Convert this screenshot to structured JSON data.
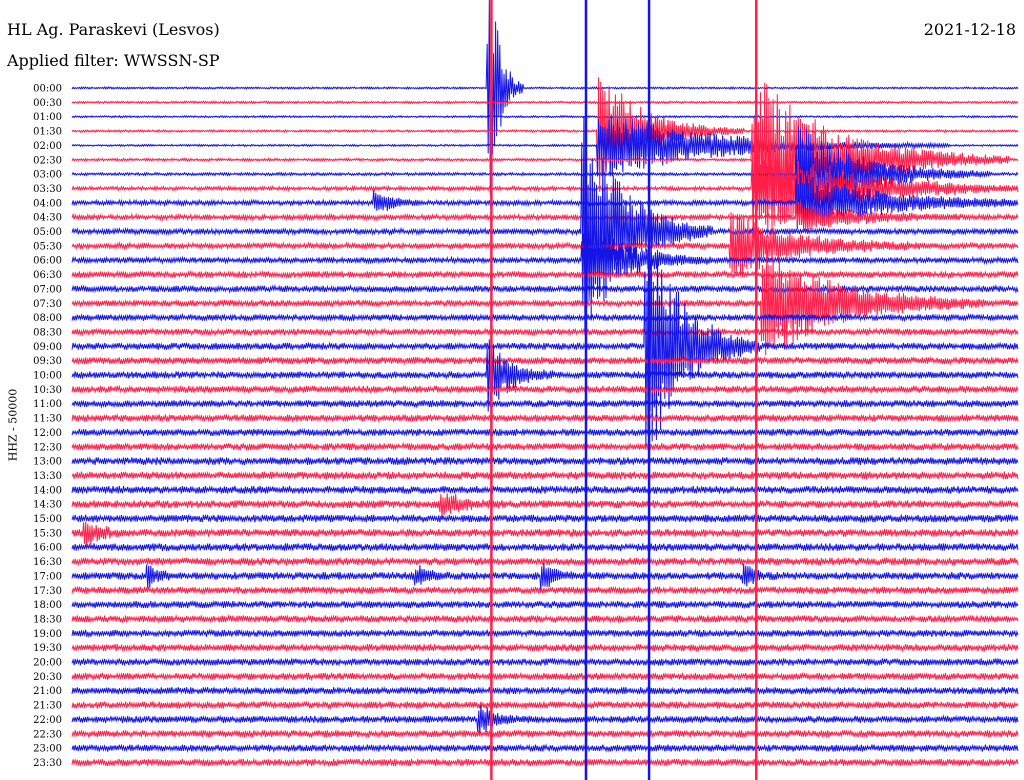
{
  "header": {
    "station": "HL Ag. Paraskevi (Lesvos)",
    "filter": "Applied filter: WWSSN-SP",
    "date": "2021-12-18",
    "channel": "HHZ - 50000"
  },
  "colors": {
    "trace_a": "#1414e6",
    "trace_b": "#ff1f4b"
  },
  "chart_data": {
    "type": "line",
    "title": "HL Ag. Paraskevi (Lesvos)",
    "subtitle": "Applied filter: WWSSN-SP",
    "date": "2021-12-18",
    "ylabel": "HHZ - 50000",
    "xlabel": "",
    "row_labels": [
      "00:00",
      "00:30",
      "01:00",
      "01:30",
      "02:00",
      "02:30",
      "03:00",
      "03:30",
      "04:00",
      "04:30",
      "05:00",
      "05:30",
      "06:00",
      "06:30",
      "07:00",
      "07:30",
      "08:00",
      "08:30",
      "09:00",
      "09:30",
      "10:00",
      "10:30",
      "11:00",
      "11:30",
      "12:00",
      "12:30",
      "13:00",
      "13:30",
      "14:00",
      "14:30",
      "15:00",
      "15:30",
      "16:00",
      "16:30",
      "17:00",
      "17:30",
      "18:00",
      "18:30",
      "19:00",
      "19:30",
      "20:00",
      "20:30",
      "21:00",
      "21:30",
      "22:00",
      "22:30",
      "23:00",
      "23:30"
    ],
    "row_colors": [
      "trace_a",
      "trace_b"
    ],
    "row_noise_level": [
      0.3,
      0.35,
      0.3,
      0.35,
      0.3,
      0.4,
      0.45,
      0.6,
      0.8,
      0.8,
      0.9,
      0.9,
      0.9,
      1.0,
      1.0,
      1.0,
      1.0,
      1.0,
      1.1,
      1.1,
      1.1,
      1.1,
      1.1,
      1.1,
      1.1,
      1.1,
      1.2,
      1.2,
      1.2,
      1.2,
      1.2,
      1.2,
      1.2,
      1.2,
      1.2,
      1.1,
      1.1,
      1.1,
      1.1,
      1.1,
      1.1,
      1.1,
      1.1,
      1.1,
      1.1,
      1.1,
      1.1,
      1.1
    ],
    "events": [
      {
        "row": 0,
        "minute": 13.3,
        "amp": 120,
        "duration": 1.0
      },
      {
        "row": 3,
        "minute": 16.8,
        "amp": 60,
        "duration": 4.5
      },
      {
        "row": 4,
        "minute": 16.8,
        "amp": 35,
        "duration": 11
      },
      {
        "row": 5,
        "minute": 21.7,
        "amp": 90,
        "duration": 8
      },
      {
        "row": 6,
        "minute": 23.1,
        "amp": 55,
        "duration": 6
      },
      {
        "row": 7,
        "minute": 21.7,
        "amp": 50,
        "duration": 9
      },
      {
        "row": 8,
        "minute": 23.1,
        "amp": 30,
        "duration": 8
      },
      {
        "row": 9,
        "minute": 23.1,
        "amp": 15,
        "duration": 6
      },
      {
        "row": 10,
        "minute": 16.3,
        "amp": 120,
        "duration": 4
      },
      {
        "row": 11,
        "minute": 21.0,
        "amp": 35,
        "duration": 6
      },
      {
        "row": 12,
        "minute": 16.3,
        "amp": 45,
        "duration": 4
      },
      {
        "row": 15,
        "minute": 22.0,
        "amp": 60,
        "duration": 7
      },
      {
        "row": 18,
        "minute": 18.3,
        "amp": 130,
        "duration": 3.5
      },
      {
        "row": 20,
        "minute": 13.3,
        "amp": 35,
        "duration": 2
      },
      {
        "row": 8,
        "minute": 9.7,
        "amp": 12,
        "duration": 1.5
      },
      {
        "row": 29,
        "minute": 11.8,
        "amp": 12,
        "duration": 2
      },
      {
        "row": 31,
        "minute": 0.5,
        "amp": 12,
        "duration": 1.5
      },
      {
        "row": 34,
        "minute": 2.5,
        "amp": 10,
        "duration": 1
      },
      {
        "row": 34,
        "minute": 11.0,
        "amp": 10,
        "duration": 1
      },
      {
        "row": 34,
        "minute": 15.0,
        "amp": 12,
        "duration": 1.2
      },
      {
        "row": 34,
        "minute": 21.4,
        "amp": 10,
        "duration": 1
      },
      {
        "row": 44,
        "minute": 13.0,
        "amp": 15,
        "duration": 1.5
      }
    ],
    "spikes": [
      {
        "minute": 13.3,
        "from_row": 0,
        "to_row": 47,
        "color": "trace_b"
      },
      {
        "minute": 16.3,
        "from_row": 0,
        "to_row": 47,
        "color": "trace_a"
      },
      {
        "minute": 18.3,
        "from_row": 0,
        "to_row": 47,
        "color": "trace_a"
      },
      {
        "minute": 21.7,
        "from_row": 0,
        "to_row": 47,
        "color": "trace_b"
      }
    ]
  }
}
